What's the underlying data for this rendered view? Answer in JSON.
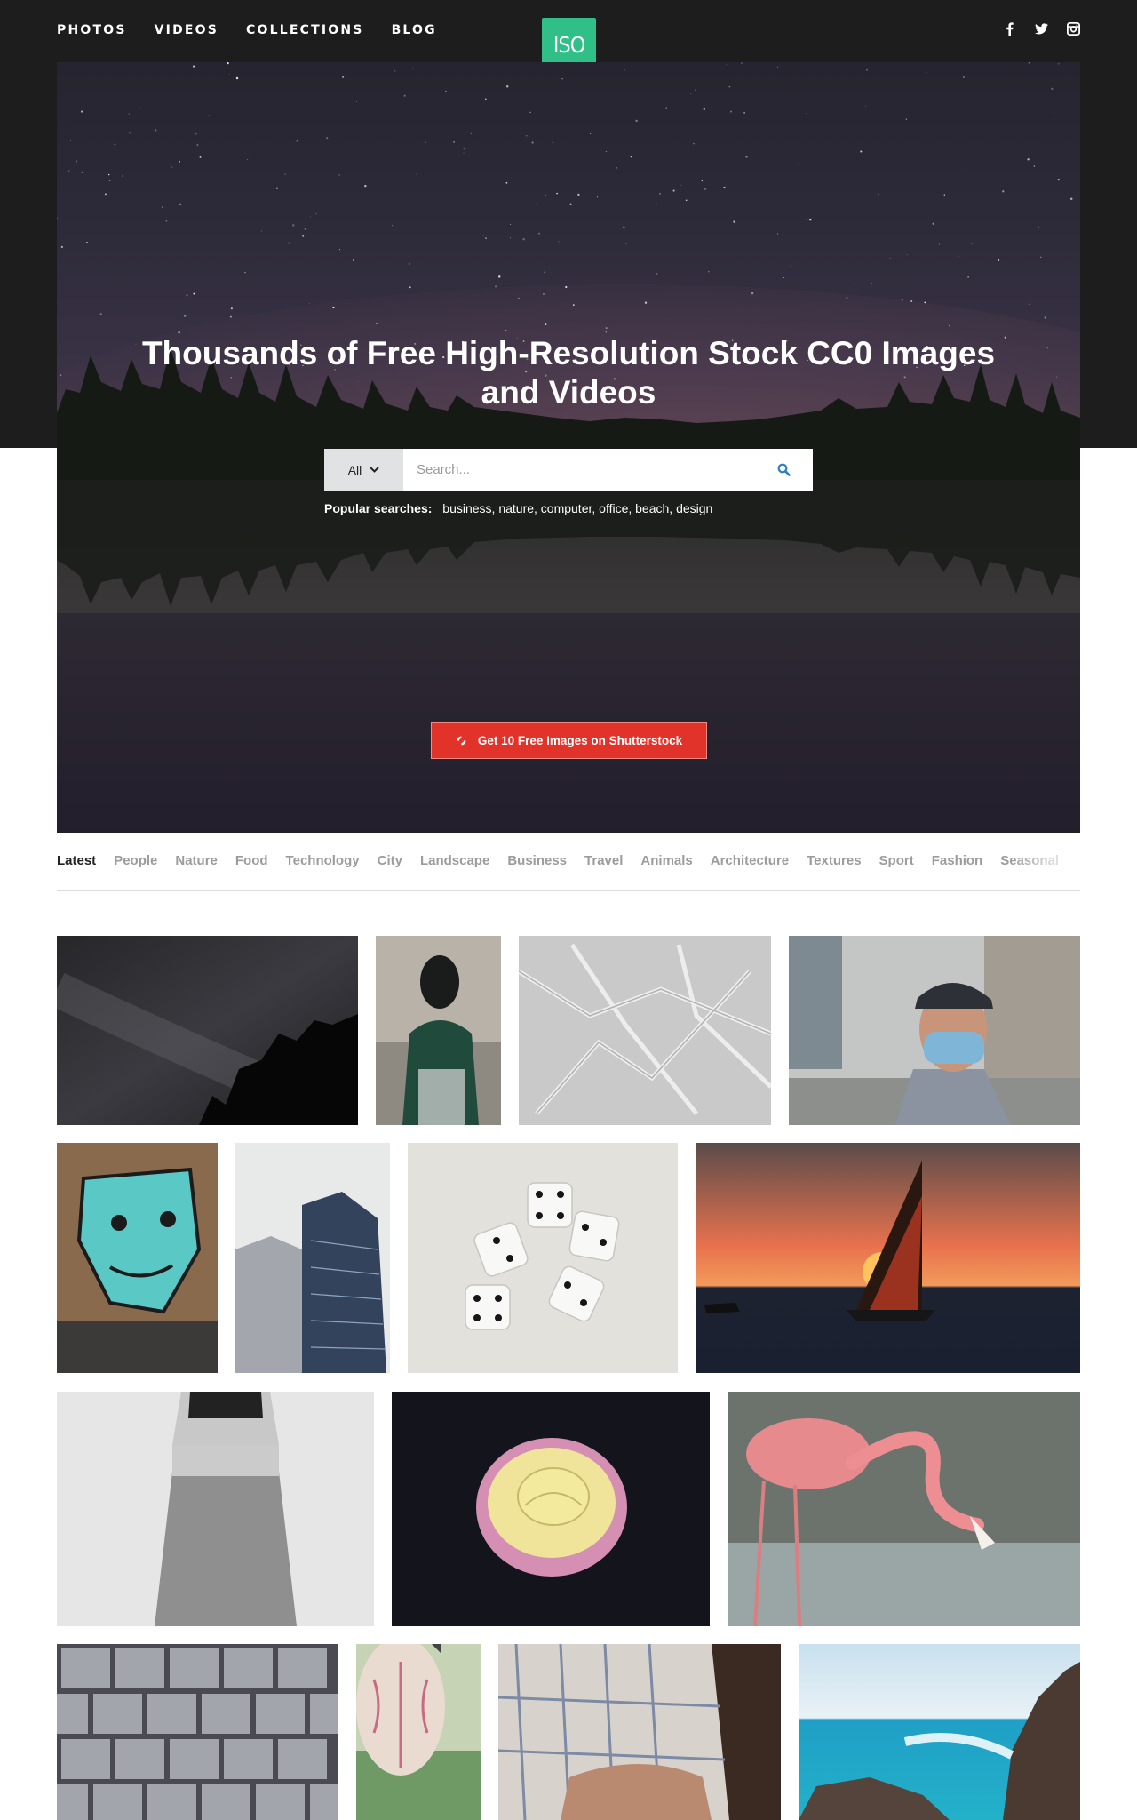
{
  "nav": {
    "items": [
      "PHOTOS",
      "VIDEOS",
      "COLLECTIONS",
      "BLOG"
    ]
  },
  "logo": {
    "text": "ISO"
  },
  "social": {
    "icons": [
      "facebook-icon",
      "twitter-icon",
      "instagram-icon"
    ]
  },
  "hero": {
    "title": "Thousands of Free High-Resolution Stock CC0 Images and Videos",
    "search": {
      "category": "All",
      "placeholder": "Search..."
    },
    "popular": {
      "label": "Popular searches:",
      "terms": "business, nature, computer, office, beach, design"
    },
    "cta": "Get 10 Free Images on Shutterstock"
  },
  "tabs": [
    "Latest",
    "People",
    "Nature",
    "Food",
    "Technology",
    "City",
    "Landscape",
    "Business",
    "Travel",
    "Animals",
    "Architecture",
    "Textures",
    "Sport",
    "Fashion",
    "Seasonal"
  ],
  "active_tab": "Latest",
  "colors": {
    "logo": "#2fbf87",
    "cta": "#e2332a",
    "dark_band": "#1d1d1e"
  },
  "photos": [
    "starry-sky",
    "woman-green-sweater",
    "frosted-branches",
    "man-face-mask",
    "graffiti-wall",
    "skyscrapers",
    "dice",
    "sailboat-sunset",
    "woman-jeans",
    "yellow-rose",
    "flamingo",
    "paving-tiles",
    "paper-lantern",
    "bed-sheets",
    "ocean-rocks"
  ]
}
